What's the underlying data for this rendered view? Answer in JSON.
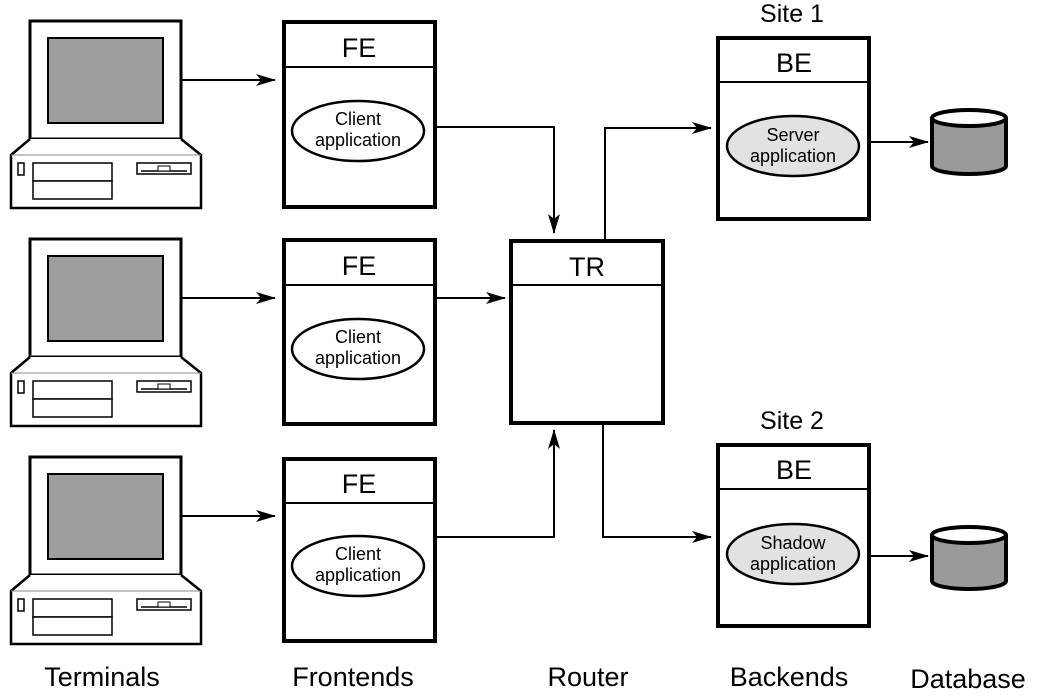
{
  "diagram": {
    "terminals": [
      {
        "name": "terminal-1"
      },
      {
        "name": "terminal-2"
      },
      {
        "name": "terminal-3"
      }
    ],
    "frontends": [
      {
        "title": "FE",
        "app_line1": "Client",
        "app_line2": "application"
      },
      {
        "title": "FE",
        "app_line1": "Client",
        "app_line2": "application"
      },
      {
        "title": "FE",
        "app_line1": "Client",
        "app_line2": "application"
      }
    ],
    "router": {
      "title": "TR"
    },
    "backends": [
      {
        "site": "Site 1",
        "title": "BE",
        "app_line1": "Server",
        "app_line2": "application"
      },
      {
        "site": "Site 2",
        "title": "BE",
        "app_line1": "Shadow",
        "app_line2": "application"
      }
    ],
    "databases": [
      {
        "name": "database-site-1"
      },
      {
        "name": "database-site-2"
      }
    ],
    "column_labels": {
      "terminals": "Terminals",
      "frontends": "Frontends",
      "router": "Router",
      "backends": "Backends",
      "database": "Database"
    },
    "colors": {
      "stroke": "#000000",
      "screen": "#9e9e9e",
      "db_body": "#9a9a9a",
      "server_app_fill": "#e2e2e2",
      "background": "#ffffff"
    }
  }
}
